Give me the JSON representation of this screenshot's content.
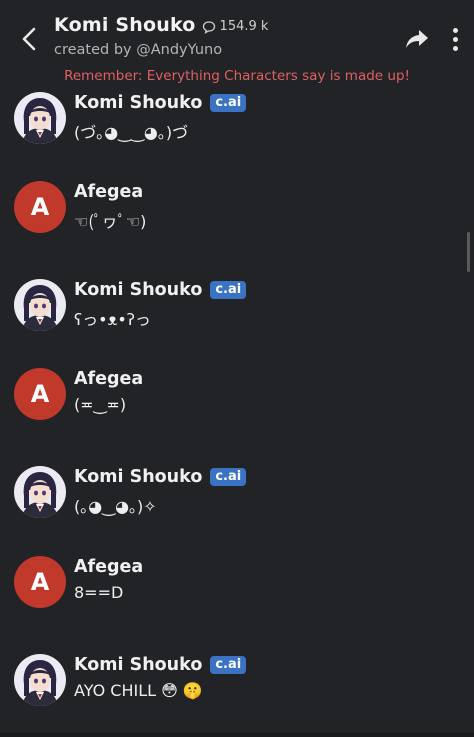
{
  "header": {
    "title": "Komi Shouko",
    "chat_count": "154.9 k",
    "creator": "created by @AndyYuno",
    "disclaimer": "Remember: Everything Characters say is made up!"
  },
  "colors": {
    "background": "#222326",
    "disclaimer": "#e06060",
    "badge": "#3b73c4",
    "user_avatar": "#c0392b"
  },
  "messages": [
    {
      "sender": "Komi Shouko",
      "badge": "c.ai",
      "text": "(づ｡◕‿‿◕｡)づ"
    },
    {
      "sender": "Afegea",
      "avatar_letter": "A",
      "text": "☜(ﾟヮﾟ☜)"
    },
    {
      "sender": "Komi Shouko",
      "badge": "c.ai",
      "text": "ʕっ•ᴥ•ʔっ"
    },
    {
      "sender": "Afegea",
      "avatar_letter": "A",
      "text": "(≖‿≖)"
    },
    {
      "sender": "Komi Shouko",
      "badge": "c.ai",
      "text": "(｡◕‿◕｡)✧"
    },
    {
      "sender": "Afegea",
      "avatar_letter": "A",
      "text": "8==D"
    },
    {
      "sender": "Komi Shouko",
      "badge": "c.ai",
      "text": "AYO CHILL 😳 🤫"
    }
  ]
}
